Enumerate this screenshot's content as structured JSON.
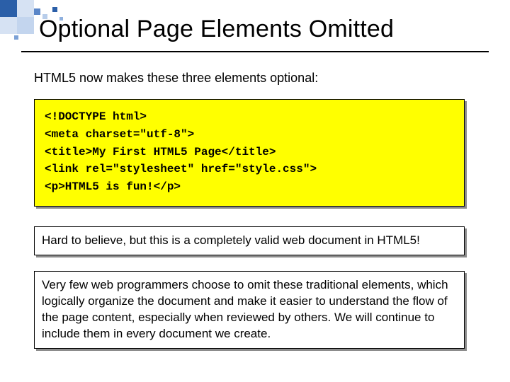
{
  "title": "Optional Page Elements Omitted",
  "intro": "HTML5 now makes these three elements optional:",
  "code": {
    "l1": "<!DOCTYPE html>",
    "l2": "<meta charset=\"utf-8\">",
    "l3": "<title>My First HTML5 Page</title>",
    "l4": "<link rel=\"stylesheet\" href=\"style.css\">",
    "l5": "<p>HTML5 is fun!</p>"
  },
  "box1": "Hard to believe, but this is a completely valid web document in HTML5!",
  "box2": "Very few web programmers choose to omit these traditional elements, which logically organize the document and make it easier to understand the flow of the page content, especially when reviewed by others.  We will continue to include them in every document we create."
}
